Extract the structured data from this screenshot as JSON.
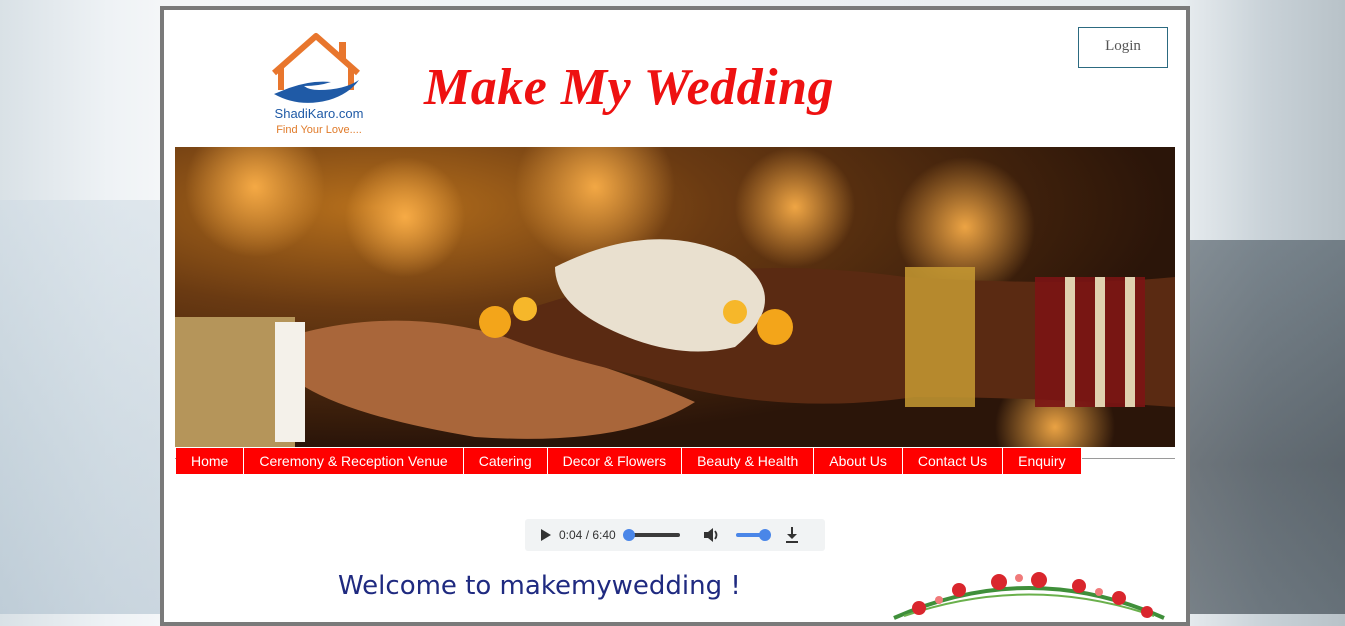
{
  "header": {
    "logo_name": "ShadiKaro.com",
    "logo_tagline": "Find Your Love....",
    "site_title": "Make My Wedding",
    "login_label": "Login"
  },
  "nav": {
    "items": [
      {
        "label": "Home"
      },
      {
        "label": "Ceremony & Reception Venue"
      },
      {
        "label": "Catering"
      },
      {
        "label": "Decor & Flowers"
      },
      {
        "label": "Beauty & Health"
      },
      {
        "label": "About Us"
      },
      {
        "label": "Contact Us"
      },
      {
        "label": "Enquiry"
      }
    ],
    "accent_color": "#ff0000"
  },
  "audio": {
    "current_time": "0:04",
    "separator": " / ",
    "duration": "6:40",
    "play_icon": "play-icon",
    "volume_icon": "volume-icon",
    "download_icon": "download-icon"
  },
  "main": {
    "welcome_text": "Welcome to makemywedding !"
  },
  "colors": {
    "title_red": "#ee1111",
    "welcome_blue": "#1f2a80",
    "logo_orange": "#e8762d",
    "logo_blue": "#1f5aa6"
  }
}
